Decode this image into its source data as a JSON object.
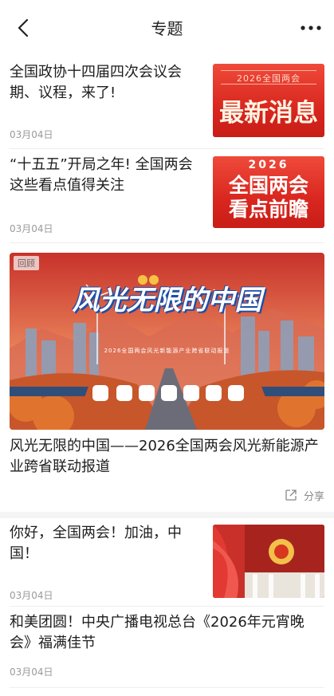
{
  "header": {
    "title": "专题"
  },
  "articles": [
    {
      "title": "全国政协十四届四次会议会期、议程，来了!",
      "date": "03月04日",
      "thumb_small": "2026全国两会",
      "thumb_big": "最新消息"
    },
    {
      "title": "“十五五”开局之年! 全国两会这些看点值得关注",
      "date": "03月04日",
      "thumb_small": "2026",
      "thumb_big_1": "全国两会",
      "thumb_big_2": "看点前瞻"
    }
  ],
  "feature": {
    "badge": "回顾",
    "banner_title": "风光无限的中国",
    "banner_subtitle": "2026全国两会风光新能源产业跨省联动报道",
    "title": "风光无限的中国——2026全国两会风光新能源产业跨省联动报道",
    "share_label": "分享"
  },
  "articles_more": [
    {
      "title": "你好，全国两会！加油，中国！",
      "date": "03月04日"
    },
    {
      "title": "和美团圆！中央广播电视总台《2026年元宵晚会》福满佳节",
      "date": "03月04日"
    }
  ],
  "colors": {
    "accent_red": "#d9271f",
    "date_gray": "#9a9a9a",
    "divider": "#eeeeee"
  }
}
